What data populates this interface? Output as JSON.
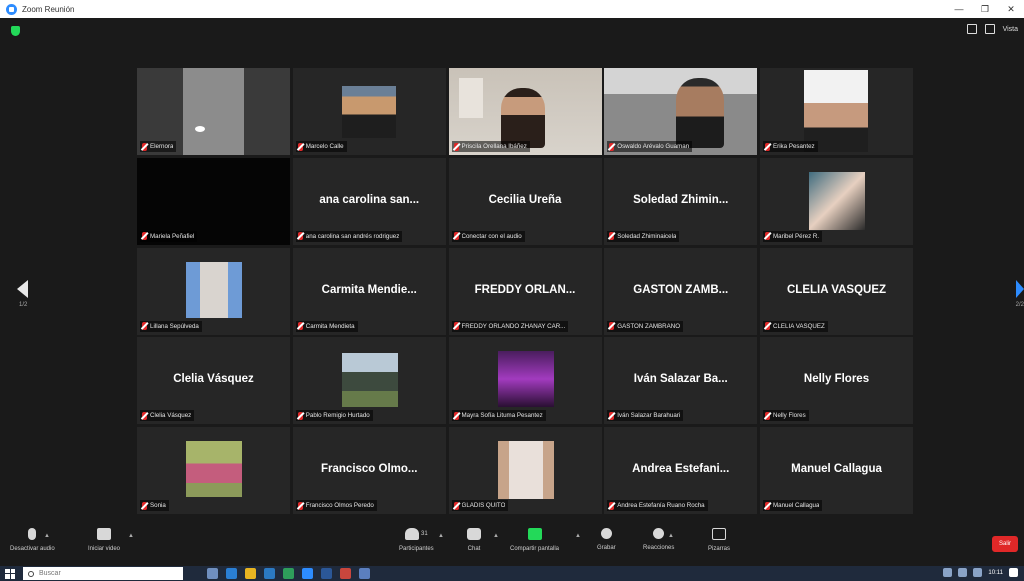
{
  "window": {
    "title": "Zoom Reunión"
  },
  "colors": {
    "accent": "#2d8cff",
    "active_speaker": "#b3d23c",
    "muted": "#e02828",
    "end": "#e02828"
  },
  "top_right": {
    "view_label": "Vista"
  },
  "pagination": {
    "left": "1/2",
    "right": "2/2"
  },
  "tiles": [
    {
      "kind": "video",
      "label": "Elernora"
    },
    {
      "kind": "photo",
      "label": "Marcelo Calle"
    },
    {
      "kind": "video",
      "label": "Priscila Orellana Ibáñez"
    },
    {
      "kind": "video",
      "label": "Oswaldo Arévalo Guaman"
    },
    {
      "kind": "photo",
      "label": "Erika Pesantez"
    },
    {
      "kind": "black",
      "label": "Mariela Peñafiel"
    },
    {
      "kind": "name",
      "big": "ana carolina san...",
      "label": "ana carolina san andrés rodriguez"
    },
    {
      "kind": "name",
      "big": "Cecilia Ureña",
      "label": "Conectar con el audio"
    },
    {
      "kind": "name",
      "big": "Soledad Zhimin...",
      "label": "Soledad Zhiminaicela"
    },
    {
      "kind": "photo",
      "label": "Maribel Pérez R."
    },
    {
      "kind": "photo",
      "label": "Lillana Sepúlveda"
    },
    {
      "kind": "name",
      "big": "Carmita Mendie...",
      "label": "Carmita Mendieta"
    },
    {
      "kind": "name",
      "big": "FREDDY ORLAN...",
      "label": "FREDDY ORLANDO ZHAÑAY CAR..."
    },
    {
      "kind": "name",
      "big": "GASTON ZAMB...",
      "label": "GASTON ZAMBRANO"
    },
    {
      "kind": "name",
      "big": "CLELIA VASQUEZ",
      "label": "CLELIA VASQUEZ"
    },
    {
      "kind": "name",
      "big": "Clelia Vásquez",
      "label": "Clelia Vásquez"
    },
    {
      "kind": "photo",
      "label": "Pablo Remigio Hurtado"
    },
    {
      "kind": "photo",
      "label": "Mayra Sofía Lituma Pesantez"
    },
    {
      "kind": "name",
      "big": "Iván Salazar Ba...",
      "label": "Iván Salazar Barahuari"
    },
    {
      "kind": "name",
      "big": "Nelly Flores",
      "label": "Nelly Flores"
    },
    {
      "kind": "photo",
      "label": "Sonia"
    },
    {
      "kind": "name",
      "big": "Francisco Olmo...",
      "label": "Francisco Olmos Peredo"
    },
    {
      "kind": "photo",
      "label": "GLADIS QUITO"
    },
    {
      "kind": "name",
      "big": "Andrea Estefani...",
      "label": "Andrea Estefanía Ruano Rocha"
    },
    {
      "kind": "name",
      "big": "Manuel Callagua",
      "label": "Manuel Callagua"
    }
  ],
  "toolbar": {
    "audio": "Desactivar audio",
    "video": "Iniciar video",
    "participants": "Participantes",
    "participants_count": "31",
    "chat": "Chat",
    "share": "Compartir pantalla",
    "record": "Grabar",
    "reactions": "Reacciones",
    "apps": "Pizarras",
    "end": "Salir"
  },
  "taskbar": {
    "search_placeholder": "Buscar",
    "time": "10:11"
  }
}
